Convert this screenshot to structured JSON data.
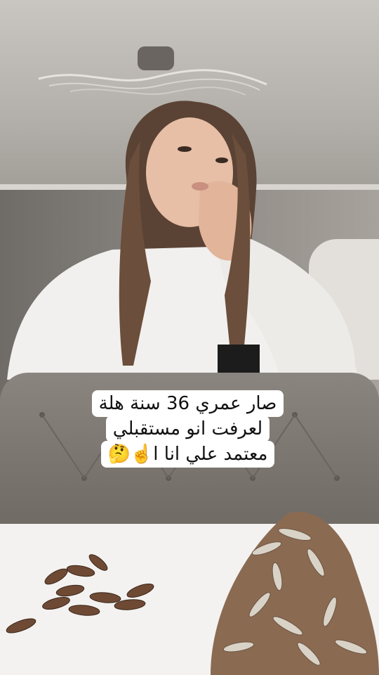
{
  "caption": {
    "lines": [
      "صار عمري 36 سنة هلة",
      "لعرفت انو مستقبلي",
      "معتمد علي انا ا☝️🤔"
    ]
  },
  "colors": {
    "caption_background": "#ffffff",
    "caption_text": "#111111",
    "sweater": "#f1f0ee",
    "sofa": "#857f7a"
  }
}
